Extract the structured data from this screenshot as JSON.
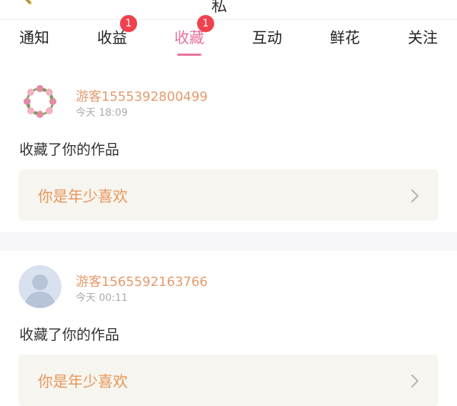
{
  "header": {
    "title_fragment": "私"
  },
  "tabs": [
    {
      "label": "通知",
      "badge": ""
    },
    {
      "label": "收益",
      "badge": "1"
    },
    {
      "label": "收藏",
      "badge": "1",
      "active": true
    },
    {
      "label": "互动",
      "badge": ""
    },
    {
      "label": "鲜花",
      "badge": ""
    },
    {
      "label": "关注",
      "badge": ""
    }
  ],
  "notifications": [
    {
      "username": "游客1555392800499",
      "time": "今天 18:09",
      "action": "收藏了你的作品",
      "work_title": "你是年少喜欢",
      "avatar": "flower-wreath"
    },
    {
      "username": "游客1565592163766",
      "time": "今天 00:11",
      "action": "收藏了你的作品",
      "work_title": "你是年少喜欢",
      "avatar": "default-person"
    }
  ],
  "colors": {
    "accent": "#e9709b",
    "badge": "#f0424e",
    "username": "#e59a6e",
    "work_title": "#e9955a",
    "work_box_bg": "#f6f5ef"
  }
}
